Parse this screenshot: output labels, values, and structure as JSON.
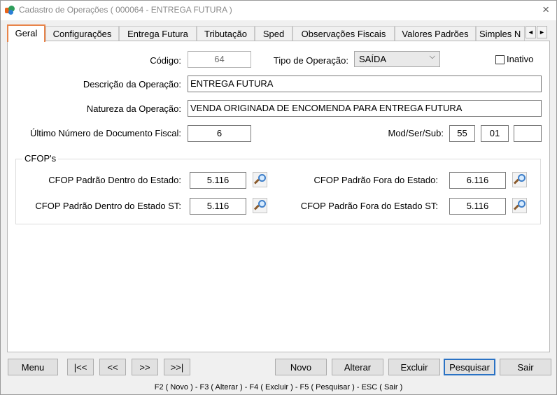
{
  "window": {
    "title": "Cadastro de Operações ( 000064 - ENTREGA FUTURA )",
    "close_glyph": "×",
    "icon": "app-logo-icon"
  },
  "tabs": [
    {
      "label": "Geral",
      "active": true
    },
    {
      "label": "Configurações"
    },
    {
      "label": "Entrega Futura"
    },
    {
      "label": "Tributação"
    },
    {
      "label": "Sped"
    },
    {
      "label": "Observações Fiscais"
    },
    {
      "label": "Valores Padrões"
    },
    {
      "label": "Simples N"
    }
  ],
  "tab_scroll": {
    "left": "◄",
    "right": "►"
  },
  "form": {
    "codigo": {
      "label": "Código:",
      "value": "64"
    },
    "tipo_operacao": {
      "label": "Tipo de Operação:",
      "value": "SAÍDA"
    },
    "inativo": {
      "label": "Inativo",
      "checked": false
    },
    "descricao": {
      "label": "Descrição da Operação:",
      "value": "ENTREGA FUTURA"
    },
    "natureza": {
      "label": "Natureza da Operação:",
      "value": "VENDA ORIGINADA DE ENCOMENDA PARA ENTREGA FUTURA"
    },
    "ultimo_numero": {
      "label": "Último Número de Documento Fiscal:",
      "value": "6"
    },
    "mod_ser_sub": {
      "label": "Mod/Ser/Sub:",
      "mod": "55",
      "ser": "01",
      "sub": ""
    }
  },
  "cfop": {
    "group_title": "CFOP's",
    "dentro_estado": {
      "label": "CFOP Padrão Dentro do Estado:",
      "value": "5.116"
    },
    "fora_estado": {
      "label": "CFOP Padrão Fora do Estado:",
      "value": "6.116"
    },
    "dentro_estado_st": {
      "label": "CFOP Padrão Dentro do Estado ST:",
      "value": "5.116"
    },
    "fora_estado_st": {
      "label": "CFOP Padrão Fora do Estado ST:",
      "value": "5.116"
    }
  },
  "buttons": {
    "menu": "Menu",
    "first": "|<<",
    "prev": "<<",
    "next": ">>",
    "last": ">>|",
    "novo": "Novo",
    "alterar": "Alterar",
    "excluir": "Excluir",
    "pesquisar": "Pesquisar",
    "sair": "Sair"
  },
  "status": {
    "shortcuts": "F2 ( Novo )  -  F3 ( Alterar )  -  F4 ( Excluir )  -  F5 ( Pesquisar )  -  ESC ( Sair )"
  },
  "colors": {
    "active_tab_border": "#e8844a",
    "primary_button_border": "#2a72c4"
  }
}
